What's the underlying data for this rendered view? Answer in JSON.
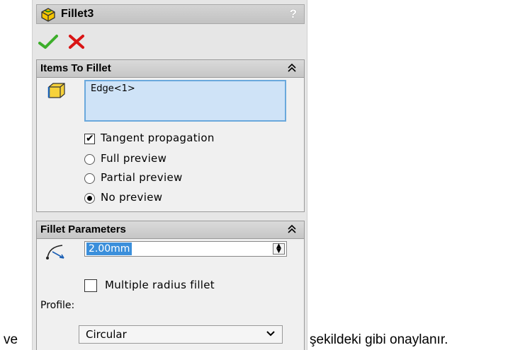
{
  "caption": {
    "prefix": "ve",
    "suffix": "şekildeki gibi onaylanır."
  },
  "panel": {
    "title": "Fillet3",
    "help_icon": "?",
    "title_icon": "fillet-feature-icon",
    "ok_icon": "green-checkmark-icon",
    "cancel_icon": "red-x-icon"
  },
  "items_to_fillet": {
    "header": "Items To Fillet",
    "selection_icon": "edge-selection-icon",
    "selected_items": [
      "Edge<1>"
    ],
    "tangent_propagation": {
      "label": "Tangent propagation",
      "checked": true
    },
    "preview_options": [
      {
        "label": "Full preview",
        "selected": false
      },
      {
        "label": "Partial preview",
        "selected": false
      },
      {
        "label": "No preview",
        "selected": true
      }
    ]
  },
  "fillet_parameters": {
    "header": "Fillet Parameters",
    "radius_icon": "radius-icon",
    "radius_value": "2.00mm",
    "multiple_radius": {
      "label": "Multiple radius fillet",
      "checked": false
    },
    "profile_label": "Profile:",
    "profile_value": "Circular"
  },
  "colors": {
    "selection_box": "#cfe3f7",
    "selection_border": "#6aa8dc",
    "highlight": "#3b8fdb",
    "ok_green": "#3cae2a",
    "cancel_red": "#d91414"
  }
}
